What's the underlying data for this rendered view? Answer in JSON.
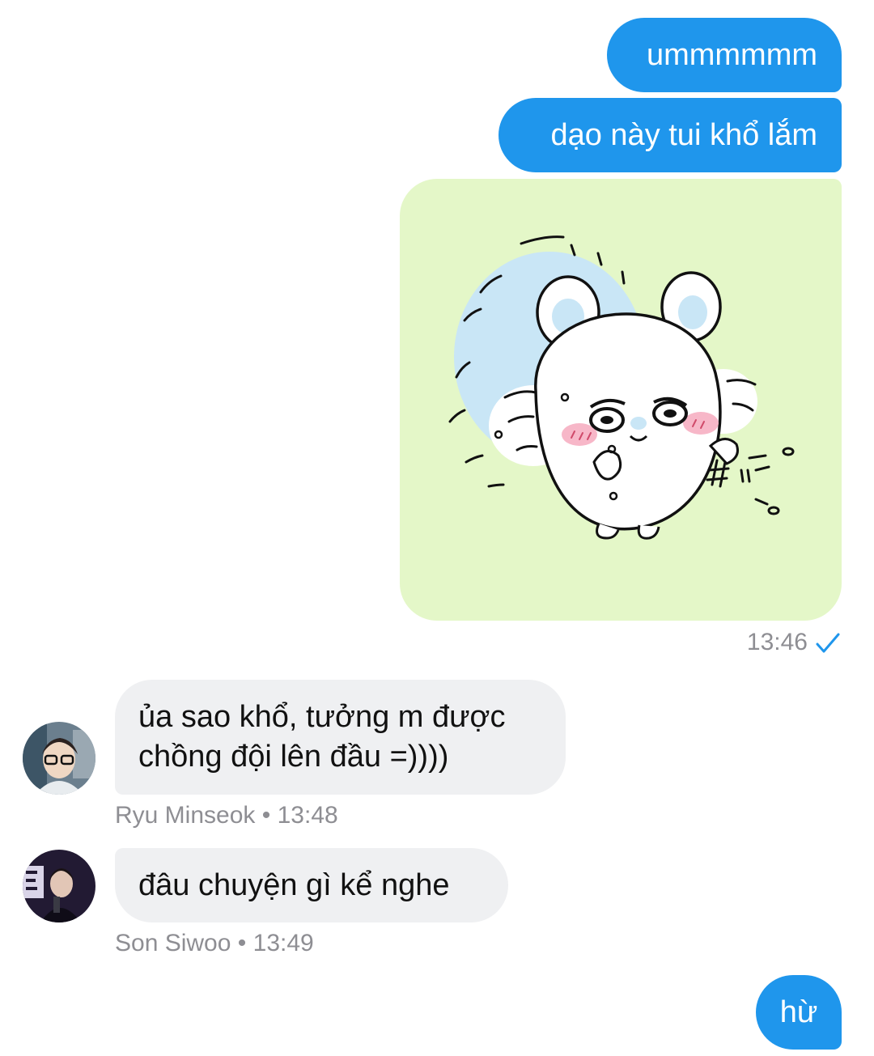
{
  "messages": [
    {
      "direction": "outgoing",
      "text": "ummmmmm"
    },
    {
      "direction": "outgoing",
      "text": "dạo này tui khổ lắm"
    },
    {
      "direction": "outgoing",
      "type": "sticker",
      "sticker": "white-hamster-sticker",
      "time": "13:46",
      "status_icon": "checkmark-icon"
    },
    {
      "direction": "incoming",
      "line1": "ủa sao khổ, tưởng m được",
      "line2": "chồng đội lên đầu =))))",
      "sender": "Ryu Minseok",
      "separator": "•",
      "time": "13:48"
    },
    {
      "direction": "incoming",
      "text": "đâu chuyện gì kể nghe",
      "sender": "Son Siwoo",
      "separator": "•",
      "time": "13:49"
    },
    {
      "direction": "outgoing",
      "text": "hừ"
    }
  ],
  "colors": {
    "outgoing_bubble": "#1f96ec",
    "incoming_bubble": "#eff0f2",
    "sticker_background": "#e4f7c8",
    "meta_text": "#8e8e93",
    "check": "#1f96ec"
  }
}
